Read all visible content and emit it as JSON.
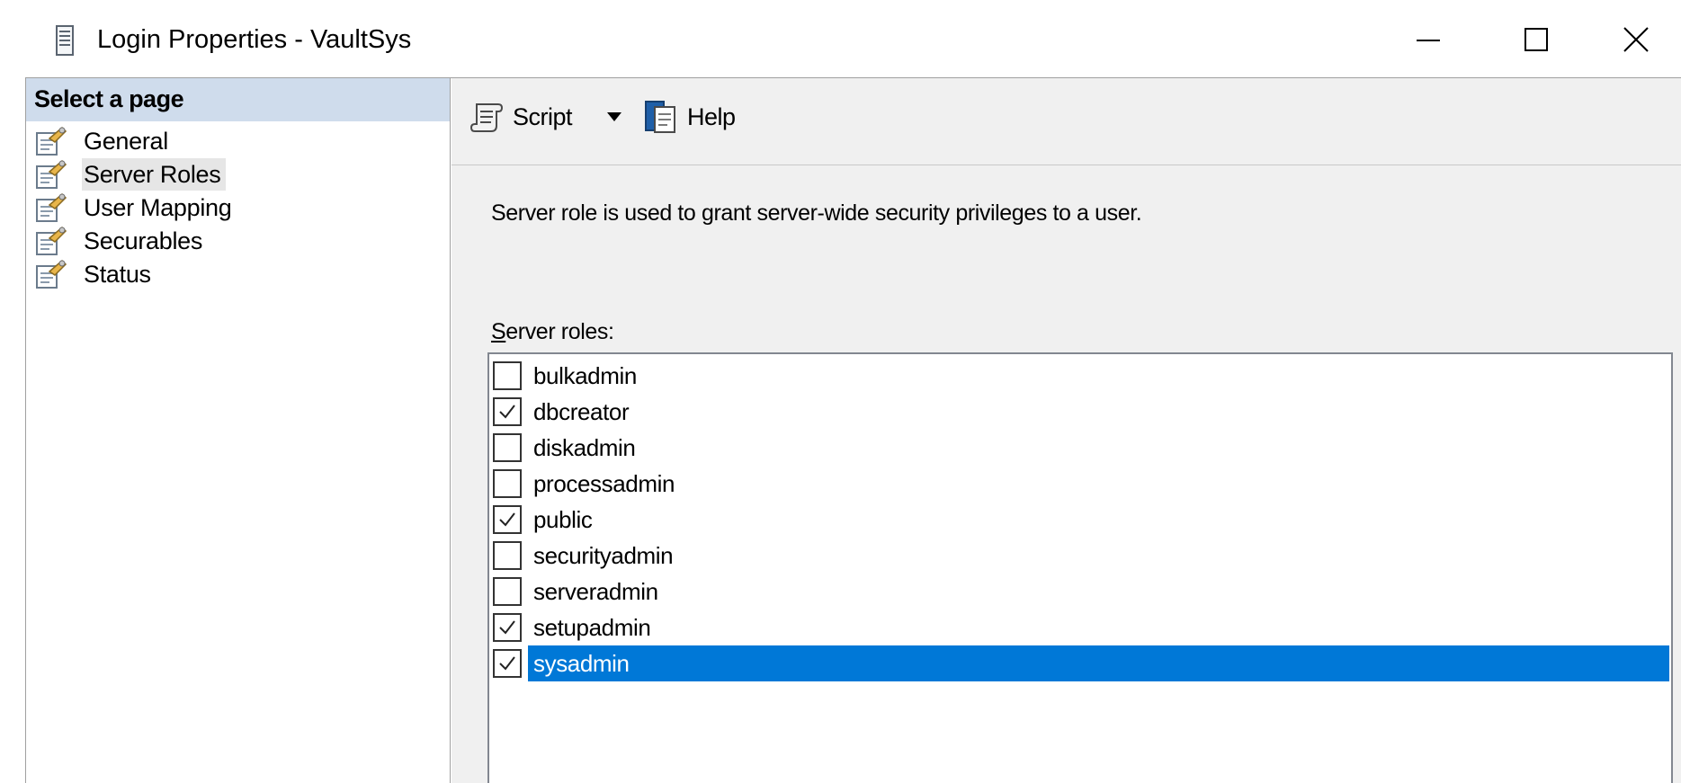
{
  "window": {
    "title": "Login Properties - VaultSys",
    "icon": "server-icon",
    "controls": {
      "minimize": "minimize-icon",
      "maximize": "maximize-icon",
      "close": "close-icon"
    }
  },
  "sidebar": {
    "header": "Select a page",
    "items": [
      {
        "label": "General",
        "icon": "page-wrench-icon",
        "selected": false
      },
      {
        "label": "Server Roles",
        "icon": "page-wrench-icon",
        "selected": true
      },
      {
        "label": "User Mapping",
        "icon": "page-wrench-icon",
        "selected": false
      },
      {
        "label": "Securables",
        "icon": "page-wrench-icon",
        "selected": false
      },
      {
        "label": "Status",
        "icon": "page-wrench-icon",
        "selected": false
      }
    ]
  },
  "toolbar": {
    "script_label": "Script",
    "help_label": "Help"
  },
  "main": {
    "description": "Server role is used to grant server-wide security privileges to a user.",
    "roles_label_mnemonic": "S",
    "roles_label_rest": "erver roles:",
    "roles": [
      {
        "name": "bulkadmin",
        "checked": false,
        "selected": false
      },
      {
        "name": "dbcreator",
        "checked": true,
        "selected": false
      },
      {
        "name": "diskadmin",
        "checked": false,
        "selected": false
      },
      {
        "name": "processadmin",
        "checked": false,
        "selected": false
      },
      {
        "name": "public",
        "checked": true,
        "selected": false
      },
      {
        "name": "securityadmin",
        "checked": false,
        "selected": false
      },
      {
        "name": "serveradmin",
        "checked": false,
        "selected": false
      },
      {
        "name": "setupadmin",
        "checked": true,
        "selected": false
      },
      {
        "name": "sysadmin",
        "checked": true,
        "selected": true
      }
    ]
  },
  "colors": {
    "header_bg": "#cfdcec",
    "selection_blue": "#0078d7",
    "pane_bg": "#f0f0f0"
  }
}
